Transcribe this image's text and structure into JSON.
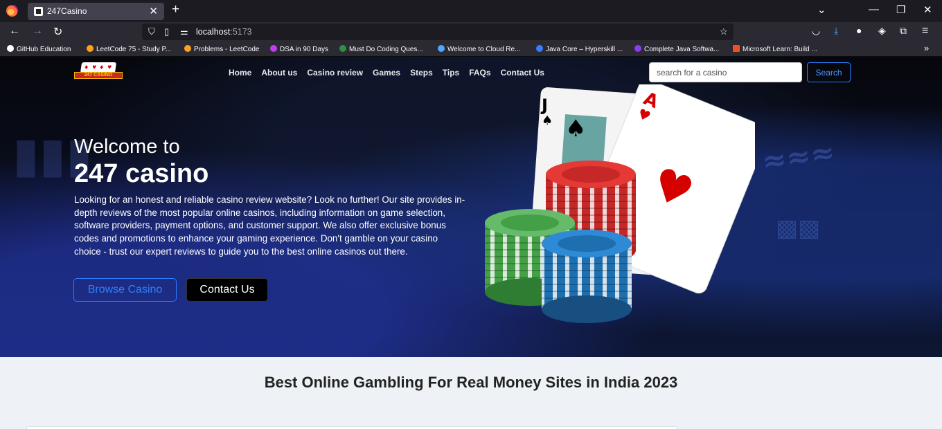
{
  "browser": {
    "tab_title": "247Casino",
    "url_host": "localhost",
    "url_port": ":5173",
    "bookmarks": [
      {
        "label": "GitHub Education",
        "color": "#ffffff"
      },
      {
        "label": "LeetCode 75 - Study P...",
        "color": "#ffa116"
      },
      {
        "label": "Problems - LeetCode",
        "color": "#ffa116"
      },
      {
        "label": "DSA in 90 Days",
        "color": "#c03cf0"
      },
      {
        "label": "Must Do Coding Ques...",
        "color": "#2f8d46"
      },
      {
        "label": "Welcome to Cloud Re...",
        "color": "#4aa8ff"
      },
      {
        "label": "Java Core – Hyperskill ...",
        "color": "#3a7bff"
      },
      {
        "label": "Complete Java Softwa...",
        "color": "#8b3cf0"
      },
      {
        "label": "Microsoft Learn: Build ...",
        "color": "#f25022"
      }
    ]
  },
  "site": {
    "logo_text": "247 CASINO",
    "nav": [
      "Home",
      "About us",
      "Casino review",
      "Games",
      "Steps",
      "Tips",
      "FAQs",
      "Contact Us"
    ],
    "search_placeholder": "search for a casino",
    "search_button": "Search"
  },
  "hero": {
    "welcome": "Welcome to",
    "brand": "247 casino",
    "description": "Looking for an honest and reliable casino review website? Look no further! Our site provides in-depth reviews of the most popular online casinos, including information on game selection, software providers, payment options, and customer support. We also offer exclusive bonus codes and promotions to enhance your gaming experience. Don't gamble on your casino choice - trust our expert reviews to guide you to the best online casinos out there.",
    "browse_button": "Browse Casino",
    "contact_button": "Contact Us"
  },
  "section": {
    "title": "Best Online Gambling For Real Money Sites in India 2023"
  }
}
